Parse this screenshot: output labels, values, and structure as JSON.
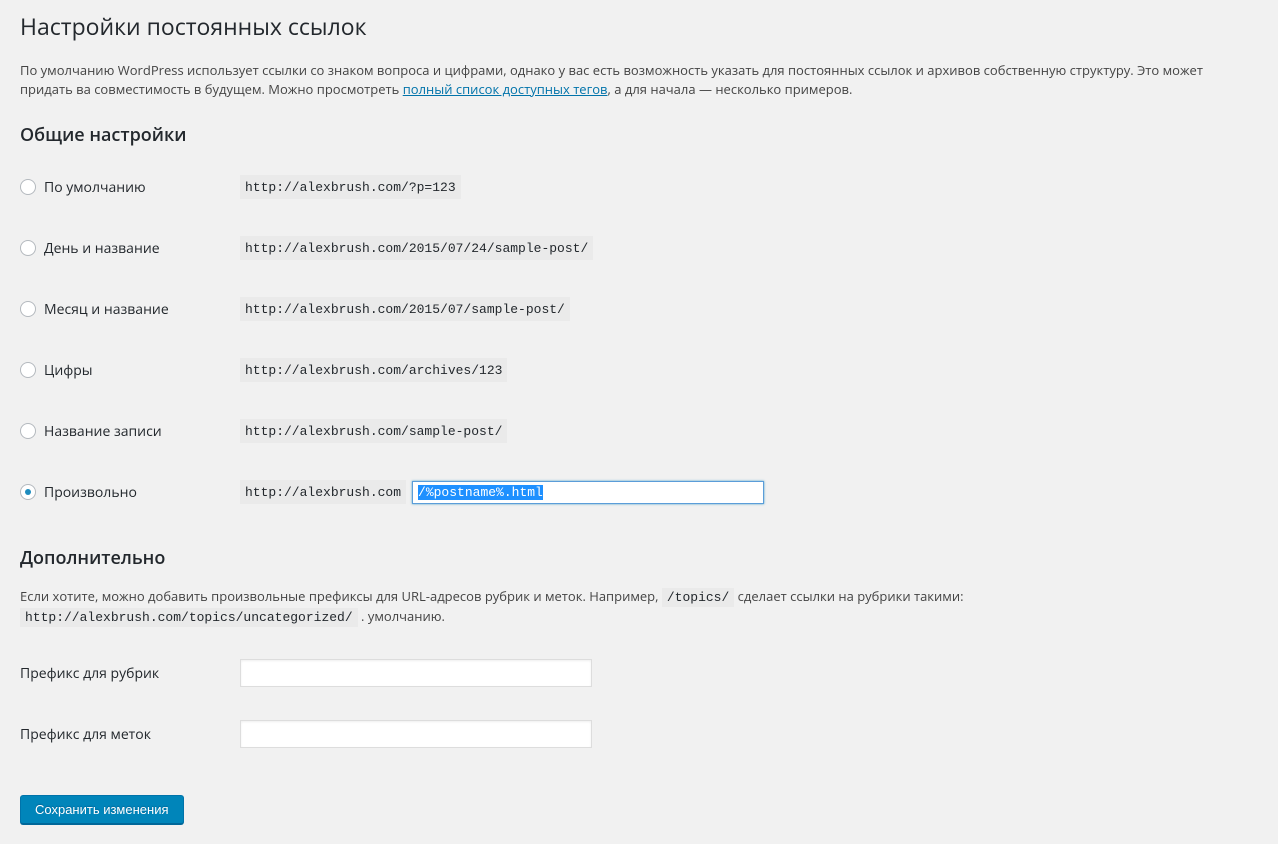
{
  "page_title": "Настройки постоянных ссылок",
  "intro_prefix": "По умолчанию WordPress использует ссылки со знаком вопроса и цифрами, однако у вас есть возможность указать для постоянных ссылок и архивов собственную структуру. Это может придать ва совместимость в будущем. Можно просмотреть ",
  "intro_link": "полный список доступных тегов",
  "intro_suffix": ", а для начала — несколько примеров.",
  "common_heading": "Общие настройки",
  "options": {
    "default": {
      "label": "По умолчанию",
      "example": "http://alexbrush.com/?p=123"
    },
    "day_name": {
      "label": "День и название",
      "example": "http://alexbrush.com/2015/07/24/sample-post/"
    },
    "month_name": {
      "label": "Месяц и название",
      "example": "http://alexbrush.com/2015/07/sample-post/"
    },
    "numeric": {
      "label": "Цифры",
      "example": "http://alexbrush.com/archives/123"
    },
    "postname": {
      "label": "Название записи",
      "example": "http://alexbrush.com/sample-post/"
    },
    "custom": {
      "label": "Произвольно",
      "prefix": "http://alexbrush.com",
      "value": "/%postname%.html"
    }
  },
  "optional_heading": "Дополнительно",
  "optional_intro_1": "Если хотите, можно добавить произвольные префиксы для URL-адресов рубрик и меток. Например, ",
  "optional_code_1": "/topics/",
  "optional_intro_2": " сделает ссылки на рубрики такими: ",
  "optional_code_2": "http://alexbrush.com/topics/uncategorized/",
  "optional_intro_3": " . умолчанию.",
  "category_base_label": "Префикс для рубрик",
  "tag_base_label": "Префикс для меток",
  "save_button": "Сохранить изменения"
}
